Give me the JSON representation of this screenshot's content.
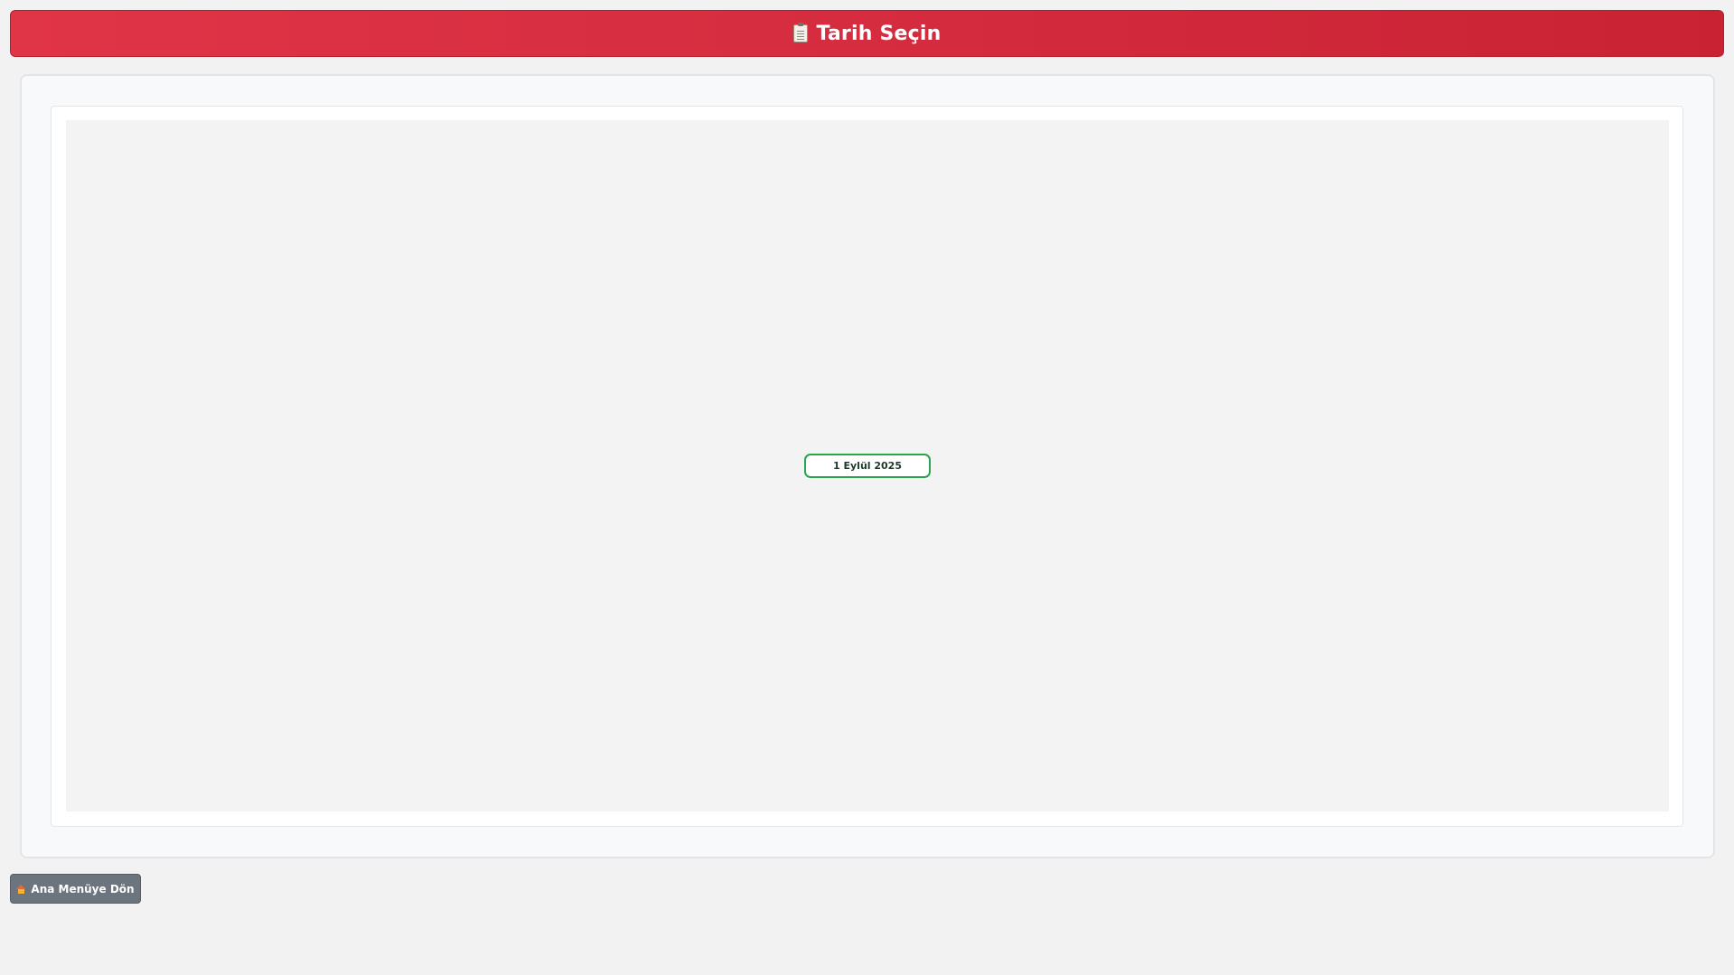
{
  "header": {
    "icon": "clipboard-icon",
    "title": "Tarih Seçin",
    "accent_color": "#d52c3f"
  },
  "calendar": {
    "selected_date_label": "1 Eylül 2025",
    "highlight_color": "#2aa44b"
  },
  "footer": {
    "back_button_icon": "house-icon",
    "back_button_label": "Ana Menüye Dön"
  }
}
